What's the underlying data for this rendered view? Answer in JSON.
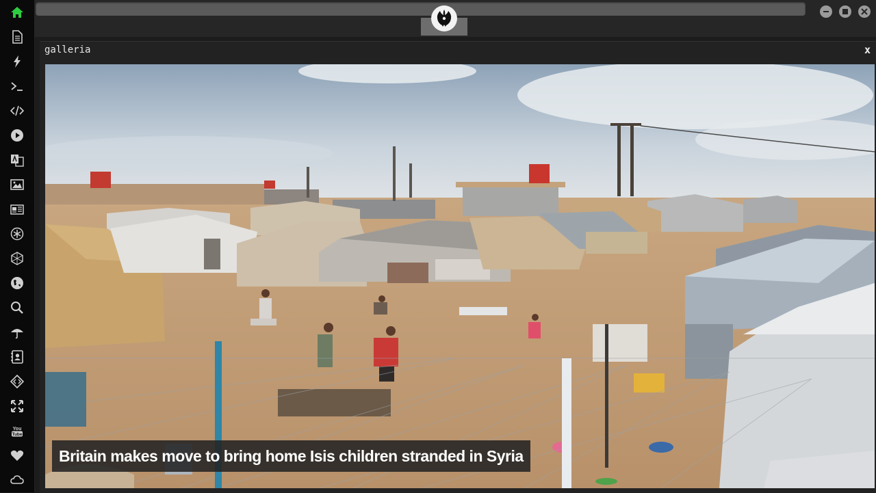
{
  "window": {
    "title": "galleria",
    "close_label": "x"
  },
  "gallery": {
    "caption": "Britain makes move to bring home Isis children stranded in Syria",
    "image_description_icon": "photo"
  },
  "dock": {
    "items": [
      {
        "icon": "home-icon",
        "active": true
      },
      {
        "icon": "document-icon"
      },
      {
        "icon": "lightning-icon"
      },
      {
        "icon": "terminal-icon"
      },
      {
        "icon": "code-icon"
      },
      {
        "icon": "play-icon"
      },
      {
        "icon": "translate-icon"
      },
      {
        "icon": "image-icon"
      },
      {
        "icon": "news-icon"
      },
      {
        "icon": "asterisk-icon"
      },
      {
        "icon": "hexagon-icon"
      },
      {
        "icon": "globe-icon"
      },
      {
        "icon": "search-icon"
      },
      {
        "icon": "umbrella-icon"
      },
      {
        "icon": "contact-icon"
      },
      {
        "icon": "diamond-code-icon"
      },
      {
        "icon": "expand-icon"
      },
      {
        "icon": "youtube-icon"
      },
      {
        "icon": "heart-icon"
      },
      {
        "icon": "cloud-icon"
      }
    ]
  },
  "colors": {
    "accent": "#2ecc40",
    "dock_icon": "#d0d0d0"
  }
}
